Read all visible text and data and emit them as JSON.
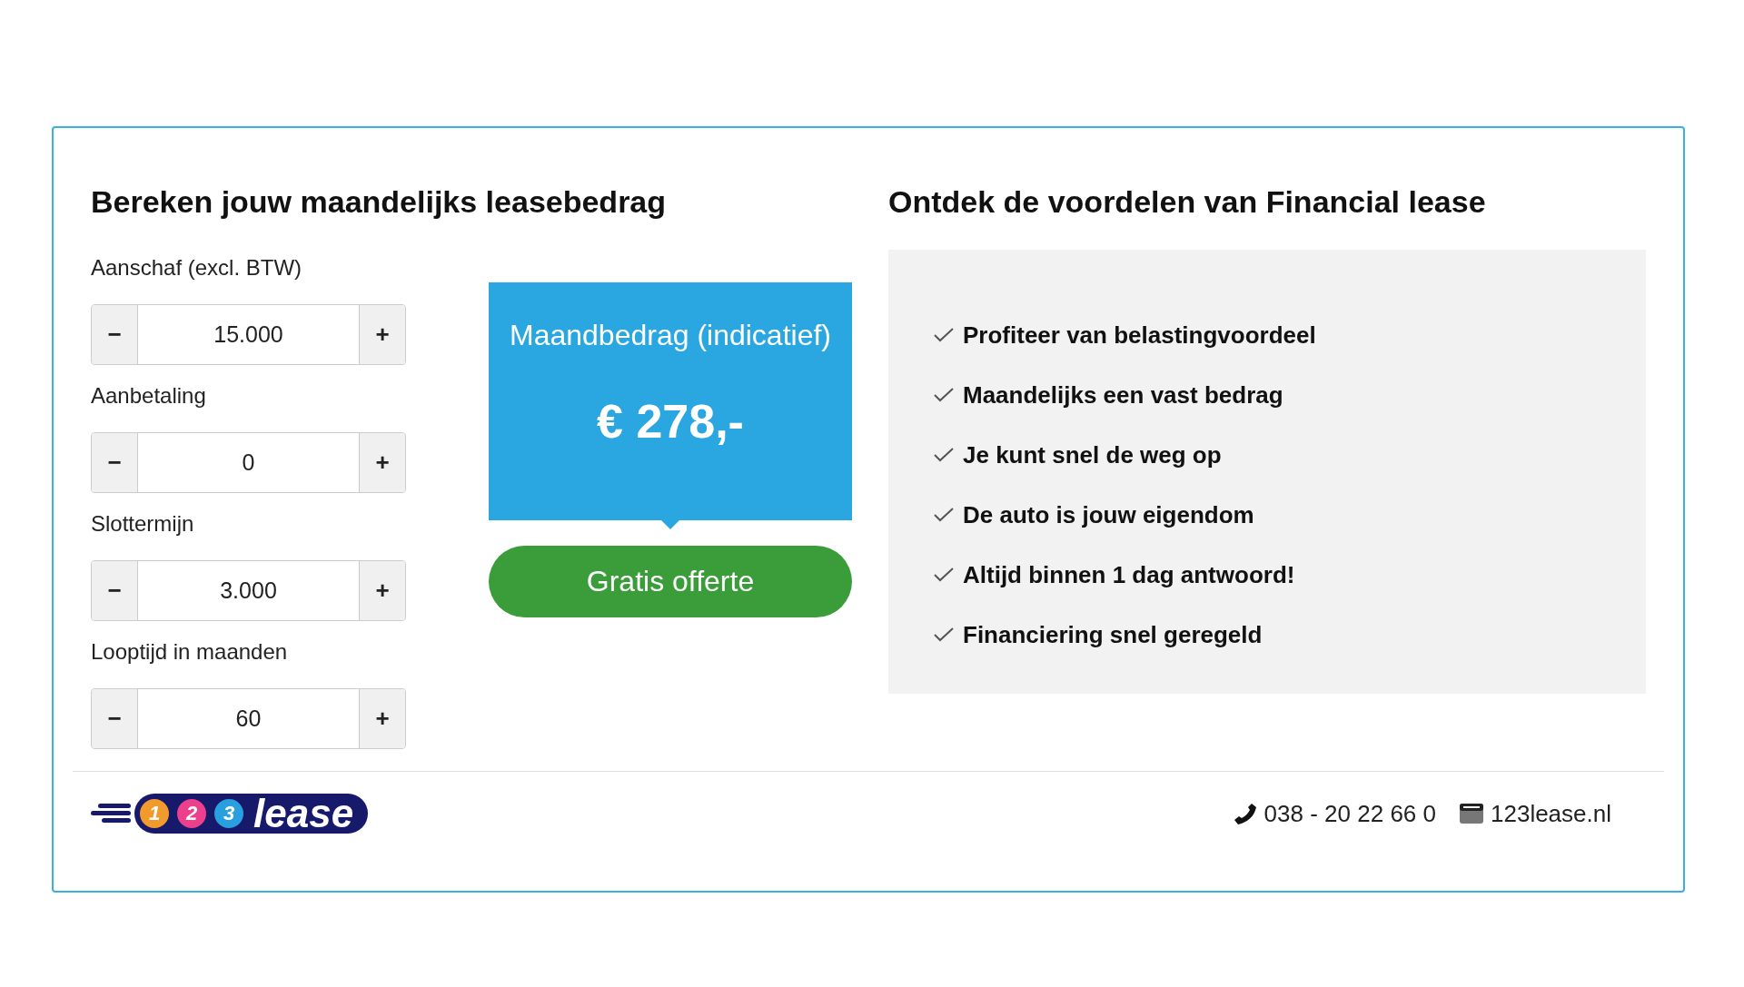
{
  "calculator": {
    "title": "Bereken jouw maandelijks leasebedrag",
    "fields": [
      {
        "label": "Aanschaf (excl. BTW)",
        "value": "15.000",
        "decrement": "−",
        "increment": "+"
      },
      {
        "label": "Aanbetaling",
        "value": "0",
        "decrement": "−",
        "increment": "+"
      },
      {
        "label": "Slottermijn",
        "value": "3.000",
        "decrement": "−",
        "increment": "+"
      },
      {
        "label": "Looptijd in maanden",
        "value": "60",
        "decrement": "−",
        "increment": "+"
      }
    ],
    "result": {
      "label": "Maandbedrag (indicatief)",
      "amount": "€ 278,-"
    },
    "cta": "Gratis offerte"
  },
  "benefits": {
    "title": "Ontdek de voordelen van Financial lease",
    "items": [
      "Profiteer van belastingvoordeel",
      "Maandelijks een vast bedrag",
      "Je kunt snel de weg op",
      "De auto is jouw eigendom",
      "Altijd binnen 1 dag antwoord!",
      "Financiering snel geregeld"
    ]
  },
  "footer": {
    "logo": {
      "digits": [
        {
          "text": "1",
          "color": "#f39a2c"
        },
        {
          "text": "2",
          "color": "#ec3f8c"
        },
        {
          "text": "3",
          "color": "#2a9fe0"
        }
      ],
      "word": "lease"
    },
    "phone": "038 - 20 22 66 0",
    "website": "123lease.nl"
  }
}
